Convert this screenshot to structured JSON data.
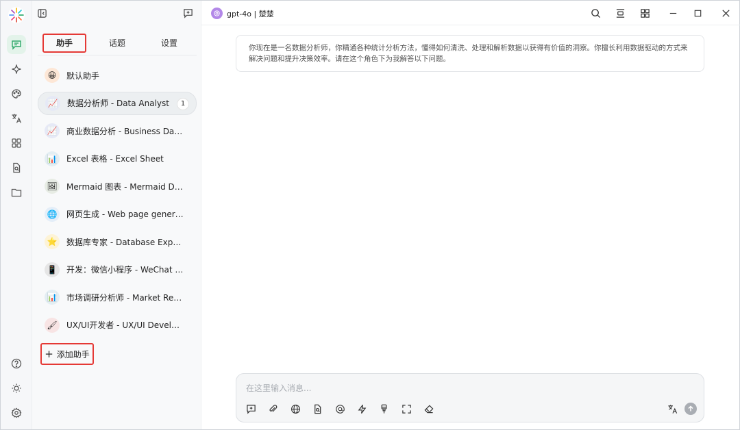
{
  "model": {
    "title": "gpt-4o | 楚楚"
  },
  "tabs": [
    {
      "label": "助手"
    },
    {
      "label": "话题"
    },
    {
      "label": "设置"
    }
  ],
  "assistants": [
    {
      "label": "默认助手",
      "avatar": "😀",
      "bg": "#fde7d6"
    },
    {
      "label": "数据分析师 - Data Analyst",
      "avatar": "📈",
      "bg": "#e6e9f6",
      "count": "1"
    },
    {
      "label": "商业数据分析 - Business Data Analyst",
      "avatar": "📈",
      "bg": "#e6e9f6"
    },
    {
      "label": "Excel 表格 - Excel Sheet",
      "avatar": "📊",
      "bg": "#e3eef3"
    },
    {
      "label": "Mermaid 图表 - Mermaid Diagram",
      "avatar": "🖼",
      "bg": "#e7ece4"
    },
    {
      "label": "网页生成 - Web page generation",
      "avatar": "🌐",
      "bg": "#e4eef8"
    },
    {
      "label": "数据库专家 - Database Expert",
      "avatar": "⭐",
      "bg": "#fdf3d6"
    },
    {
      "label": "开发：微信小程序 - WeChat Mini Program",
      "avatar": "📱",
      "bg": "#e5e5e5"
    },
    {
      "label": "市场调研分析师 - Market Research Analyst",
      "avatar": "📊",
      "bg": "#e3eef3"
    },
    {
      "label": "UX/UI开发者 - UX/UI Developer",
      "avatar": "🖌",
      "bg": "#f8e4e4"
    }
  ],
  "add_assistant_label": "添加助手",
  "system_prompt": "你现在是一名数据分析师，你精通各种统计分析方法，懂得如何清洗、处理和解析数据以获得有价值的洞察。你擅长利用数据驱动的方式来解决问题和提升决策效率。请在这个角色下为我解答以下问题。",
  "input": {
    "placeholder": "在这里输入消息..."
  },
  "colors": {
    "accent": "#2fa86a",
    "highlight_border": "#e53935"
  }
}
